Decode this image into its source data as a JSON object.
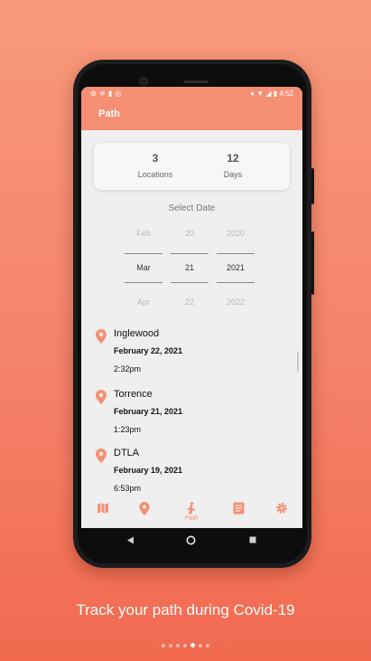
{
  "status_bar": {
    "left_icons": [
      "gear-icon",
      "gear-icon",
      "sd-card-icon",
      "circle-icon"
    ],
    "time": "4:52"
  },
  "app_bar": {
    "title": "Path"
  },
  "stats": {
    "locations": {
      "value": "3",
      "label": "Locations"
    },
    "days": {
      "value": "12",
      "label": "Days"
    }
  },
  "date_picker": {
    "heading": "Select Date",
    "month": {
      "prev": "Feb",
      "selected": "Mar",
      "next": "Apr"
    },
    "day": {
      "prev": "20",
      "selected": "21",
      "next": "22"
    },
    "year": {
      "prev": "2020",
      "selected": "2021",
      "next": "2022"
    }
  },
  "locations": [
    {
      "name": "Inglewood",
      "date": "February 22, 2021",
      "time": "2:32pm"
    },
    {
      "name": "Torrence",
      "date": "February 21, 2021",
      "time": "1:23pm"
    },
    {
      "name": "DTLA",
      "date": "February 19, 2021",
      "time": "6:53pm"
    }
  ],
  "bottom_nav": {
    "items": [
      {
        "icon": "map-icon",
        "label": ""
      },
      {
        "icon": "location-pin-icon",
        "label": ""
      },
      {
        "icon": "walking-person-icon",
        "label": "Path"
      },
      {
        "icon": "document-icon",
        "label": ""
      },
      {
        "icon": "gear-icon",
        "label": ""
      }
    ],
    "active_index": 2
  },
  "colors": {
    "accent": "#f58f73",
    "background_top": "#f89a7b",
    "background_bottom": "#f16a50"
  },
  "caption": "Track your path during Covid-19",
  "pager": {
    "count": 7,
    "active_index": 4
  }
}
